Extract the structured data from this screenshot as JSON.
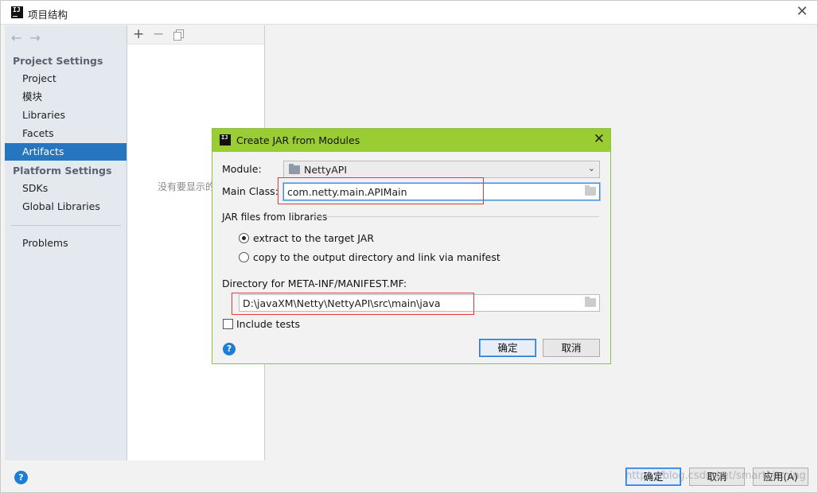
{
  "window": {
    "title": "项目结构"
  },
  "nav": {
    "back_arrow": "←",
    "forward_arrow": "→",
    "project_settings_header": "Project Settings",
    "project_settings_items": [
      "Project",
      "模块",
      "Libraries",
      "Facets",
      "Artifacts"
    ],
    "platform_settings_header": "Platform Settings",
    "platform_settings_items": [
      "SDKs",
      "Global Libraries"
    ],
    "problems": "Problems",
    "selected": "Artifacts"
  },
  "middle": {
    "toolbar": {
      "add": "+",
      "remove": "−"
    },
    "empty_text": "没有要显示的"
  },
  "footer": {
    "ok_label": "确定",
    "cancel_label": "取消",
    "apply_label": "应用(A)",
    "watermark": "https://blog.csdn.net/smartbitming"
  },
  "dialog": {
    "title": "Create JAR from Modules",
    "module_label": "Module:",
    "module_value": "NettyAPI",
    "main_class_label": "Main Class:",
    "main_class_value": "com.netty.main.APIMain",
    "jar_files_label": "JAR files from libraries",
    "radio_extract": "extract to the target JAR",
    "radio_copy": "copy to the output directory and link via manifest",
    "manifest_dir_label": "Directory for META-INF/MANIFEST.MF:",
    "manifest_dir_value": "D:\\javaXM\\Netty\\NettyAPI\\src\\main\\java",
    "include_tests": "Include tests",
    "ok_label": "确定",
    "cancel_label": "取消",
    "help_glyph": "?",
    "selected_radio": "extract to the target JAR",
    "include_tests_checked": false
  },
  "colors": {
    "accent_selected": "#2675bf",
    "dialog_title_bg": "#9acd32",
    "highlight_box": "#e23b3b"
  },
  "icons": [
    "app-icon",
    "close-icon",
    "back-arrow-icon",
    "forward-arrow-icon",
    "add-icon",
    "remove-icon",
    "copy-icon",
    "folder-icon",
    "browse-folder-icon",
    "help-icon",
    "dropdown-arrow-icon"
  ]
}
